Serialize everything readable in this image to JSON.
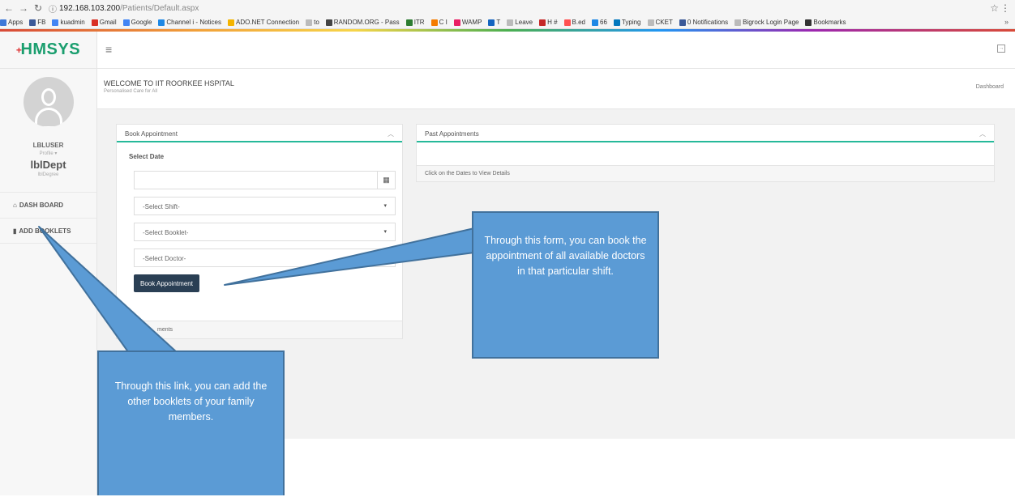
{
  "browser": {
    "url_host": "192.168.103.200",
    "url_path": "/Patients/Default.aspx",
    "info_glyph": "ⓘ",
    "bookmarks": [
      {
        "label": "Apps",
        "color": "#3c78d8"
      },
      {
        "label": "FB",
        "color": "#3b5998"
      },
      {
        "label": "kuadmin",
        "color": "#4285f4"
      },
      {
        "label": "Gmail",
        "color": "#d93025"
      },
      {
        "label": "Google",
        "color": "#4285f4"
      },
      {
        "label": "Channel i - Notices",
        "color": "#1e88e5"
      },
      {
        "label": "ADO.NET Connection",
        "color": "#f4b400"
      },
      {
        "label": "to",
        "color": "#bbbbbb"
      },
      {
        "label": "RANDOM.ORG - Pass",
        "color": "#444444"
      },
      {
        "label": "ITR",
        "color": "#2e7d32"
      },
      {
        "label": "C I",
        "color": "#f57c00"
      },
      {
        "label": "WAMP",
        "color": "#e91e63"
      },
      {
        "label": "T",
        "color": "#1565c0"
      },
      {
        "label": "Leave",
        "color": "#bbbbbb"
      },
      {
        "label": "H #",
        "color": "#c62828"
      },
      {
        "label": "B.ed",
        "color": "#ff5252"
      },
      {
        "label": "66",
        "color": "#1e88e5"
      },
      {
        "label": "Typing",
        "color": "#0277bd"
      },
      {
        "label": "CKET",
        "color": "#bbbbbb"
      },
      {
        "label": "0 Notifications",
        "color": "#3b5998"
      },
      {
        "label": "Bigrock Login Page",
        "color": "#bbbbbb"
      },
      {
        "label": "Bookmarks",
        "color": "#333333"
      }
    ],
    "more": "»"
  },
  "app": {
    "logo_plus": "+",
    "logo_text": "HMSYS"
  },
  "user": {
    "name": "LBLUSER",
    "profile": "Profile ▾",
    "dept": "lblDept",
    "degree": "lblDegree"
  },
  "sidebar": {
    "items": [
      {
        "icon": "⌂",
        "label": "DASH BOARD"
      },
      {
        "icon": "▮",
        "label": "ADD BOOKLETS"
      }
    ]
  },
  "header": {
    "title": "WELCOME TO IIT ROORKEE HSPITAL",
    "subtitle": "Personalised Care for All",
    "breadcrumb": "Dashboard"
  },
  "book_panel": {
    "title": "Book Appointment",
    "select_date": "Select Date",
    "date_value": "",
    "shift": "-Select Shift-",
    "booklet": "-Select Booklet-",
    "doctor": "-Select Doctor-",
    "button": "Book Appointment",
    "footer": "ments"
  },
  "past_panel": {
    "title": "Past Appointments",
    "footer": "Click on the Dates to View Details"
  },
  "callouts": {
    "form": "Through this form, you can book the appointment of all available doctors in that particular shift.",
    "link": "Through this link, you can add the other booklets of your family members."
  },
  "colors": {
    "accent": "#26b99a",
    "button": "#2a3f54",
    "callout": "#5b9bd5",
    "logo": "#1a9e6e"
  }
}
